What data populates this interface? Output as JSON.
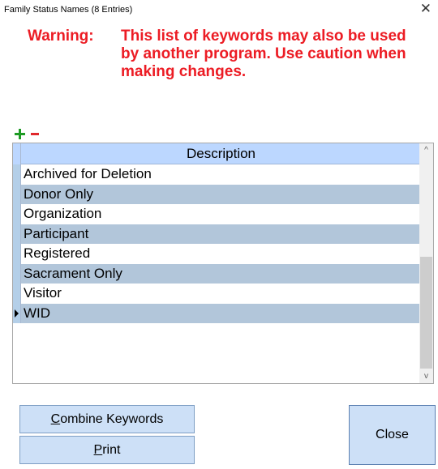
{
  "window": {
    "title": "Family Status Names (8 Entries)",
    "close_glyph": "✕"
  },
  "warning": {
    "label": "Warning:",
    "line1": "This list of keywords may also be used",
    "line2": "by another program. Use caution when",
    "line3": "making changes."
  },
  "toolbar": {
    "add_icon": "plus-icon",
    "remove_icon": "minus-icon",
    "add_color": "#1e9b24",
    "remove_color": "#e0282c"
  },
  "grid": {
    "column_header": "Description",
    "rows": [
      {
        "description": "Archived for Deletion",
        "current": false
      },
      {
        "description": "Donor Only",
        "current": false
      },
      {
        "description": "Organization",
        "current": false
      },
      {
        "description": "Participant",
        "current": false
      },
      {
        "description": "Registered",
        "current": false
      },
      {
        "description": "Sacrament Only",
        "current": false
      },
      {
        "description": "Visitor",
        "current": false
      },
      {
        "description": "WID",
        "current": true
      }
    ],
    "scroll_up_glyph": "^",
    "scroll_down_glyph": "v"
  },
  "buttons": {
    "combine_mnemonic": "C",
    "combine_rest": "ombine Keywords",
    "print_mnemonic": "P",
    "print_rest": "rint",
    "close": "Close"
  },
  "colors": {
    "warning_red": "#ec1c24",
    "header_blue": "#bcd7ff",
    "alt_row": "#b2c6da",
    "button_bg": "#cde0f7"
  }
}
